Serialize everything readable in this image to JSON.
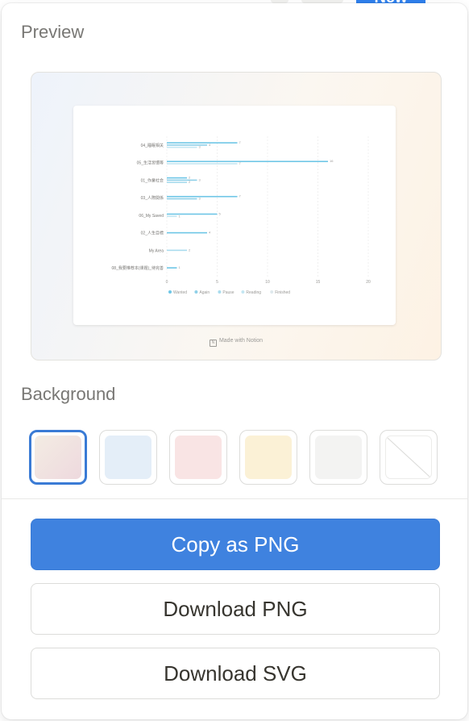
{
  "topbar": {
    "new_label": "New"
  },
  "preview": {
    "label": "Preview",
    "made_with": "Made with Notion"
  },
  "chart_data": {
    "type": "bar",
    "orientation": "horizontal",
    "categories": [
      "04_睡眠相关",
      "05_生活習慣等",
      "01_作業社会",
      "03_人際関係",
      "06_My Saved",
      "02_人生目標",
      "My Area",
      "08_我要推荐本(课题)_待完善"
    ],
    "series": [
      {
        "name": "Wanted",
        "color": "#6ec6e6",
        "values": [
          7,
          16,
          2,
          7,
          5,
          4,
          0,
          1
        ]
      },
      {
        "name": "Again",
        "color": "#8fd0e8",
        "values": [
          4,
          0,
          3,
          3,
          0,
          0,
          0,
          0
        ]
      },
      {
        "name": "Pause",
        "color": "#a9dcee",
        "values": [
          0,
          0,
          2,
          0,
          0,
          0,
          2,
          0
        ]
      },
      {
        "name": "Reading",
        "color": "#c4e6f2",
        "values": [
          3,
          7,
          0,
          0,
          1,
          0,
          0,
          0
        ]
      },
      {
        "name": "Finished",
        "color": "#dfe9ed",
        "values": [
          0,
          0,
          0,
          0,
          0,
          0,
          0,
          0
        ]
      }
    ],
    "xlim": [
      0,
      20
    ],
    "xticks": [
      "0",
      "5",
      "10",
      "15",
      "20"
    ],
    "grid": true,
    "legend_position": "bottom"
  },
  "background": {
    "label": "Background",
    "swatches": [
      {
        "name": "warm",
        "color": "linear-gradient(135deg,#f3ece3,#eed9de)",
        "selected": true
      },
      {
        "name": "blue",
        "color": "#e4eef8",
        "selected": false
      },
      {
        "name": "pink",
        "color": "#f9e4e4",
        "selected": false
      },
      {
        "name": "yellow",
        "color": "#fbf1d6",
        "selected": false
      },
      {
        "name": "gray",
        "color": "#f3f3f2",
        "selected": false
      },
      {
        "name": "none",
        "color": "#ffffff",
        "selected": false
      }
    ]
  },
  "actions": {
    "copy_png": "Copy as PNG",
    "download_png": "Download PNG",
    "download_svg": "Download SVG"
  }
}
